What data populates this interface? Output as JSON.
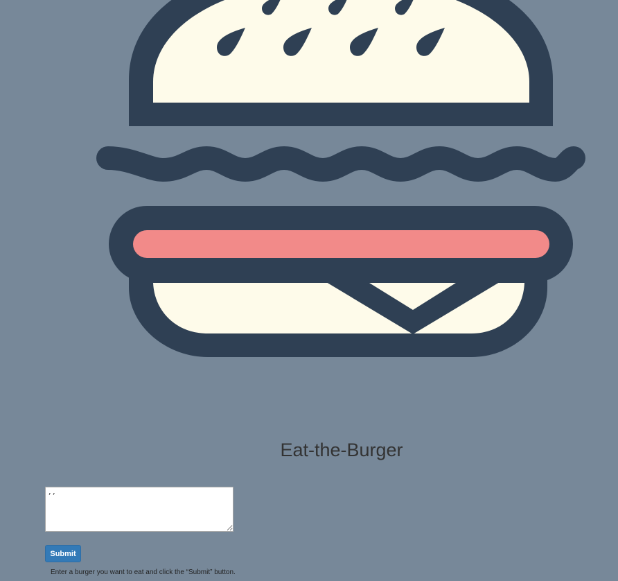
{
  "app": {
    "title": "Eat-the-Burger"
  },
  "form": {
    "textarea_value": "‚‚",
    "submit_label": "Submit",
    "hint": "Enter a burger you want to eat and click the “Submit” button."
  },
  "colors": {
    "background": "#778899",
    "outline": "#2f4054",
    "bun": "#fefbea",
    "patty": "#f28a89",
    "button": "#337ab7"
  },
  "icons": {
    "logo": "burger-icon"
  }
}
